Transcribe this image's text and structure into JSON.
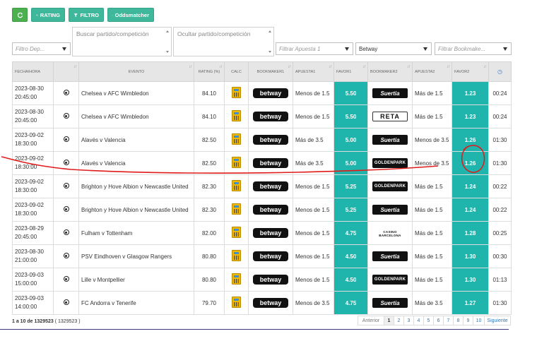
{
  "toolbar": {
    "refresh_icon": "refresh-icon",
    "rating_label": "RATING",
    "filtro_label": "FILTRO",
    "oddsmatcher_label": "Oddsmatcher"
  },
  "filters": {
    "deporte_placeholder": "Filtro Dep...",
    "buscar_placeholder": "Buscar partido/competición",
    "ocultar_placeholder": "Ocultar partido/competición",
    "apuesta_placeholder": "Filtrar Apuesta 1",
    "bookmaker1_value": "Betway",
    "bookmaker2_placeholder": "Filtrar Bookmake..."
  },
  "columns": {
    "fecha": "FECHA/HORA",
    "evento": "EVENTO",
    "rating": "RATING (%)",
    "calc": "CALC",
    "bookmaker1": "BOOKMAKER1",
    "apuesta1": "APUESTA1",
    "favor1": "FAVOR1",
    "bookmaker2": "BOOKMAKER2",
    "apuesta2": "APUESTA2",
    "favor2": "FAVOR2"
  },
  "rows": [
    {
      "date": "2023-08-30",
      "time": "20:45:00",
      "event": "Chelsea v AFC Wimbledon",
      "rating": "84.10",
      "bm1": "betway",
      "ap1": "Menos de 1.5",
      "fav1": "5.50",
      "bm2": "Suertia",
      "bm2_type": "suertia",
      "ap2": "Más de 1.5",
      "fav2": "1.23",
      "left": "00:24"
    },
    {
      "date": "2023-08-30",
      "time": "20:45:00",
      "event": "Chelsea v AFC Wimbledon",
      "rating": "84.10",
      "bm1": "betway",
      "ap1": "Menos de 1.5",
      "fav1": "5.50",
      "bm2": "RETA",
      "bm2_type": "reta",
      "ap2": "Más de 1.5",
      "fav2": "1.23",
      "left": "00:24"
    },
    {
      "date": "2023-09-02",
      "time": "18:30:00",
      "event": "Alavés v Valencia",
      "rating": "82.50",
      "bm1": "betway",
      "ap1": "Más de 3.5",
      "fav1": "5.00",
      "bm2": "Suertia",
      "bm2_type": "suertia",
      "ap2": "Menos de 3.5",
      "fav2": "1.26",
      "left": "01:30"
    },
    {
      "date": "2023-09-02",
      "time": "18:30:00",
      "event": "Alavés v Valencia",
      "rating": "82.50",
      "bm1": "betway",
      "ap1": "Más de 3.5",
      "fav1": "5.00",
      "bm2": "GOLDENPARK",
      "bm2_type": "golden",
      "ap2": "Menos de 3.5",
      "fav2": "1.26",
      "left": "01:30"
    },
    {
      "date": "2023-09-02",
      "time": "18:30:00",
      "event": "Brighton y Hove Albion v Newcastle United",
      "rating": "82.30",
      "bm1": "betway",
      "ap1": "Menos de 1.5",
      "fav1": "5.25",
      "bm2": "GOLDENPARK",
      "bm2_type": "golden",
      "ap2": "Más de 1.5",
      "fav2": "1.24",
      "left": "00:22"
    },
    {
      "date": "2023-09-02",
      "time": "18:30:00",
      "event": "Brighton y Hove Albion v Newcastle United",
      "rating": "82.30",
      "bm1": "betway",
      "ap1": "Menos de 1.5",
      "fav1": "5.25",
      "bm2": "Suertia",
      "bm2_type": "suertia",
      "ap2": "Más de 1.5",
      "fav2": "1.24",
      "left": "00:22"
    },
    {
      "date": "2023-08-29",
      "time": "20:45:00",
      "event": "Fulham v Tottenham",
      "rating": "82.00",
      "bm1": "betway",
      "ap1": "Menos de 1.5",
      "fav1": "4.75",
      "bm2": "CASINO BARCELONA",
      "bm2_type": "casino",
      "ap2": "Más de 1.5",
      "fav2": "1.28",
      "left": "00:25"
    },
    {
      "date": "2023-08-30",
      "time": "21:00:00",
      "event": "PSV Eindhoven v Glasgow Rangers",
      "rating": "80.80",
      "bm1": "betway",
      "ap1": "Menos de 1.5",
      "fav1": "4.50",
      "bm2": "Suertia",
      "bm2_type": "suertia",
      "ap2": "Más de 1.5",
      "fav2": "1.30",
      "left": "00:30"
    },
    {
      "date": "2023-09-03",
      "time": "15:00:00",
      "event": "Lille v Montpellier",
      "rating": "80.80",
      "bm1": "betway",
      "ap1": "Menos de 1.5",
      "fav1": "4.50",
      "bm2": "GOLDENPARK",
      "bm2_type": "golden",
      "ap2": "Más de 1.5",
      "fav2": "1.30",
      "left": "01:13"
    },
    {
      "date": "2023-09-03",
      "time": "14:00:00",
      "event": "FC Andorra v Tenerife",
      "rating": "79.70",
      "bm1": "betway",
      "ap1": "Menos de 3.5",
      "fav1": "4.75",
      "bm2": "Suertia",
      "bm2_type": "suertia",
      "ap2": "Más de 3.5",
      "fav2": "1.27",
      "left": "01:30"
    }
  ],
  "footer": {
    "range": "1 a 10 de 1329523",
    "total": "( 1329523 )"
  },
  "pagination": {
    "prev": "Anterior",
    "pages": [
      "1",
      "2",
      "3",
      "4",
      "5",
      "6",
      "7",
      "8",
      "9",
      "10"
    ],
    "next": "Siguiente",
    "active": "1"
  },
  "colors": {
    "accent_teal": "#1fb4ac",
    "button_green": "#3eb79a",
    "annotation_red": "#e01b1b"
  }
}
